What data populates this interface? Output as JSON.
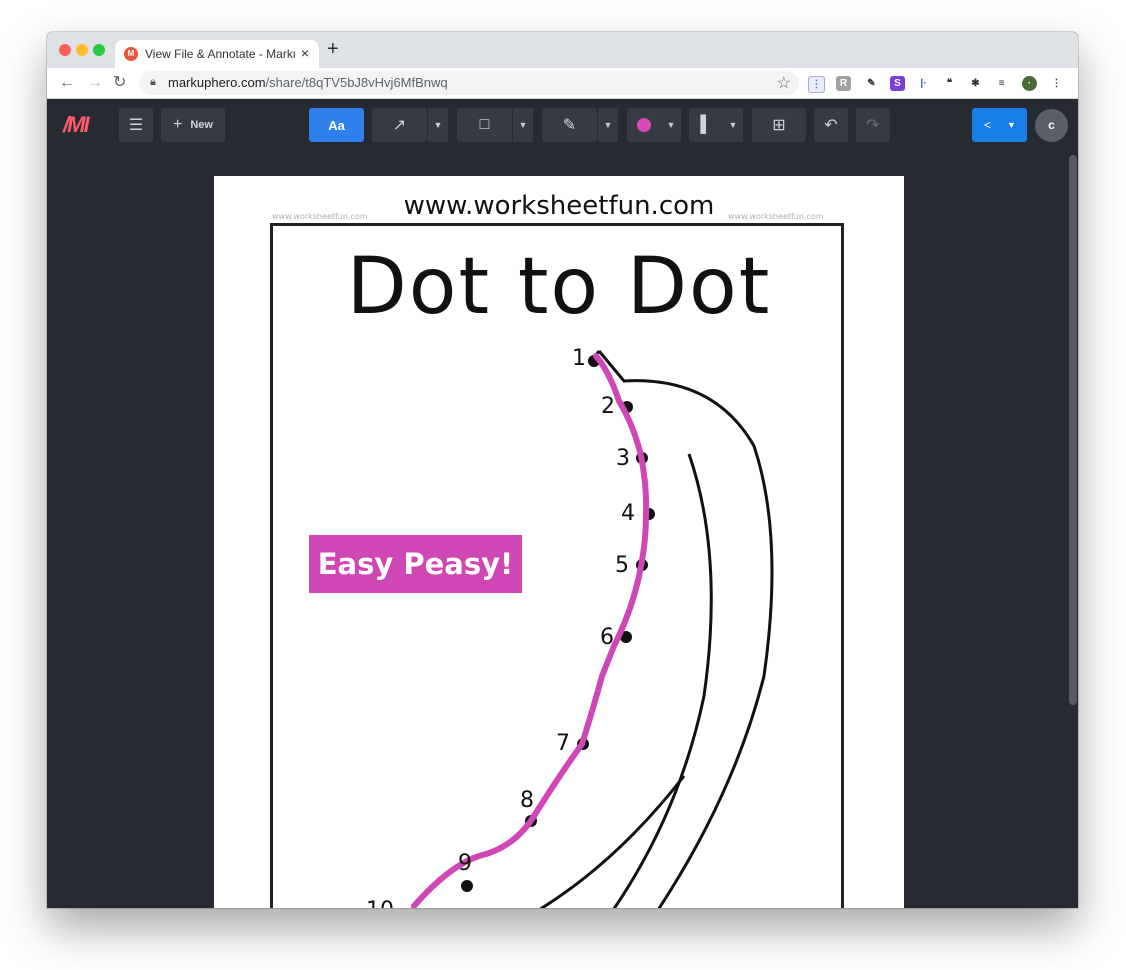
{
  "browser": {
    "tab_title": "View File & Annotate - Markup",
    "tab_close": "×",
    "new_tab": "+",
    "url_domain": "markuphero.com",
    "url_path": "/share/t8qTV5bJ8vHvj6MfBnwq"
  },
  "app": {
    "logo": "/MI",
    "new_label": "New",
    "text_tool_label": "Aa",
    "avatar_initial": "c",
    "accent_color": "#2f80ed",
    "annotation_color": "#d448b8"
  },
  "worksheet": {
    "site_big": "www.worksheetfun.com",
    "site_small": "www.worksheetfun.com",
    "title": "Dot to Dot",
    "dot_numbers": [
      "1",
      "2",
      "3",
      "4",
      "5",
      "6",
      "7",
      "8",
      "9",
      "10"
    ],
    "annotation_text": "Easy Peasy!"
  }
}
